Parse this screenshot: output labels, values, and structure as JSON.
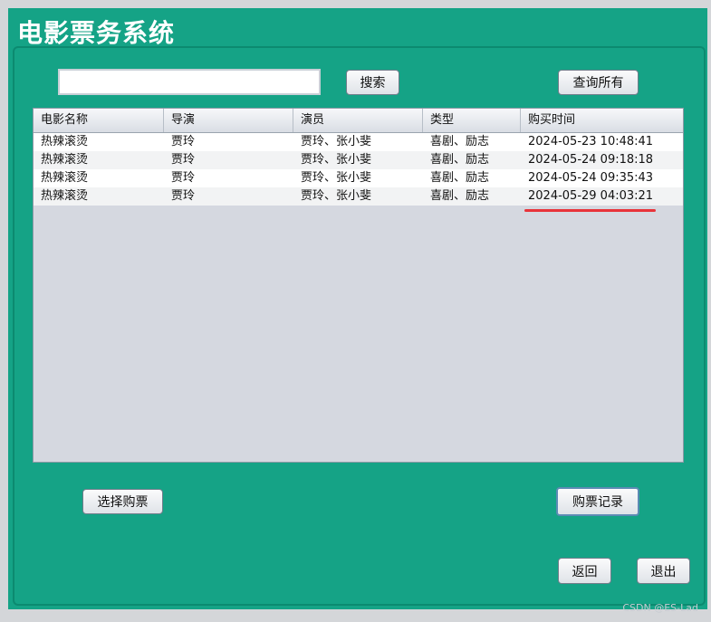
{
  "app": {
    "title": "电影票务系统"
  },
  "search": {
    "placeholder": "",
    "value": "",
    "search_label": "搜索",
    "query_all_label": "查询所有"
  },
  "table": {
    "columns": [
      "电影名称",
      "导演",
      "演员",
      "类型",
      "购买时间"
    ],
    "rows": [
      [
        "热辣滚烫",
        "贾玲",
        "贾玲、张小斐",
        "喜剧、励志",
        "2024-05-23 10:48:41"
      ],
      [
        "热辣滚烫",
        "贾玲",
        "贾玲、张小斐",
        "喜剧、励志",
        "2024-05-24 09:18:18"
      ],
      [
        "热辣滚烫",
        "贾玲",
        "贾玲、张小斐",
        "喜剧、励志",
        "2024-05-24 09:35:43"
      ],
      [
        "热辣滚烫",
        "贾玲",
        "贾玲、张小斐",
        "喜剧、励志",
        "2024-05-29 04:03:21"
      ]
    ]
  },
  "actions": {
    "select_ticket_label": "选择购票",
    "purchase_history_label": "购票记录",
    "back_label": "返回",
    "exit_label": "退出"
  },
  "watermark": "CSDN @ES-Lad",
  "colors": {
    "window_bg": "#15a386",
    "highlight_underline": "#e8333a"
  }
}
